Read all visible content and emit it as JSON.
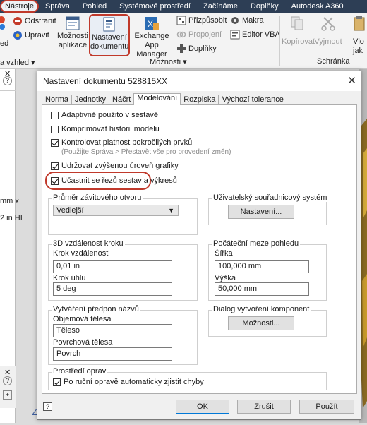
{
  "menu": {
    "items": [
      {
        "label": "Nástroje",
        "active": true
      },
      {
        "label": "Správa"
      },
      {
        "label": "Pohled"
      },
      {
        "label": "Systémové prostředí"
      },
      {
        "label": "Začínáme"
      },
      {
        "label": "Doplňky"
      },
      {
        "label": "Autodesk A360"
      }
    ]
  },
  "ribbon": {
    "left_partial": {
      "odstranit": "Odstranit",
      "upravit": "Upravit",
      "ed": "ed",
      "vzhled_group": "a vzhled"
    },
    "moznosti_aplikace": [
      "Možnosti",
      "aplikace"
    ],
    "nastaveni_dokumentu": [
      "Nastavení",
      "dokumentu"
    ],
    "exchange": [
      "Exchange",
      "App Manager"
    ],
    "prizpusobit": "Přizpůsobit",
    "propojeni": "Propojení",
    "doplnky": "Doplňky",
    "makra": "Makra",
    "editor_vba": "Editor VBA",
    "moznosti_group": "Možnosti",
    "kopirovat": "Kopírovat",
    "vyjmout": "Vyjmout",
    "schranka_group": "Schránka",
    "vlo_partial": [
      "Vlo",
      "jak"
    ]
  },
  "left_panel": {
    "texts": [
      "mm x",
      "2 in HI"
    ]
  },
  "viewport": {
    "z_label": "Z"
  },
  "dialog": {
    "title": "Nastavení dokumentu 528815XX",
    "close": "✕",
    "tabs": [
      "Norma",
      "Jednotky",
      "Náčrt",
      "Modelování",
      "Rozpiska",
      "Výchozí tolerance"
    ],
    "active_tab": "Modelování",
    "checkboxes": {
      "adaptivne": {
        "label": "Adaptivně použito v sestavě",
        "checked": false
      },
      "komprimovat": {
        "label": "Komprimovat historii modelu",
        "checked": false
      },
      "kontrolovat": {
        "label": "Kontrolovat platnost pokročilých prvků",
        "checked": true
      },
      "kontrolovat_hint": "(Použijte Správa > Přestavět vše pro provedení změn)",
      "udrzovat": {
        "label": "Udržovat zvýšenou úroveň grafiky",
        "checked": true
      },
      "ucastnit": {
        "label": "Účastnit se řezů sestav a výkresů",
        "checked": true
      }
    },
    "prumer": {
      "title": "Průměr závitového otvoru",
      "value": "Vedlejší"
    },
    "uzivatelsky": {
      "title": "Uživatelský souřadnicový systém",
      "button": "Nastavení..."
    },
    "krok3d": {
      "title": "3D vzdálenost kroku",
      "krok_vzd_label": "Krok vzdálenosti",
      "krok_vzd_value": "0,01 in",
      "krok_uhlu_label": "Krok úhlu",
      "krok_uhlu_value": "5 deg"
    },
    "pocatecni": {
      "title": "Počáteční meze pohledu",
      "sirka_label": "Šířka",
      "sirka_value": "100,000 mm",
      "vyska_label": "Výška",
      "vyska_value": "50,000 mm"
    },
    "predpon": {
      "title": "Vytváření předpon názvů",
      "objem_label": "Objemová tělesa",
      "objem_value": "Těleso",
      "povrch_label": "Povrchová tělesa",
      "povrch_value": "Povrch"
    },
    "dialog_komponent": {
      "title": "Dialog vytvoření komponent",
      "button": "Možnosti..."
    },
    "prostredi": {
      "title": "Prostředí oprav",
      "checkbox": {
        "label": "Po ruční opravě automaticky zjistit chyby",
        "checked": true
      }
    },
    "buttons": {
      "ok": "OK",
      "zrusit": "Zrušit",
      "pouzit": "Použít"
    },
    "help": "?"
  }
}
